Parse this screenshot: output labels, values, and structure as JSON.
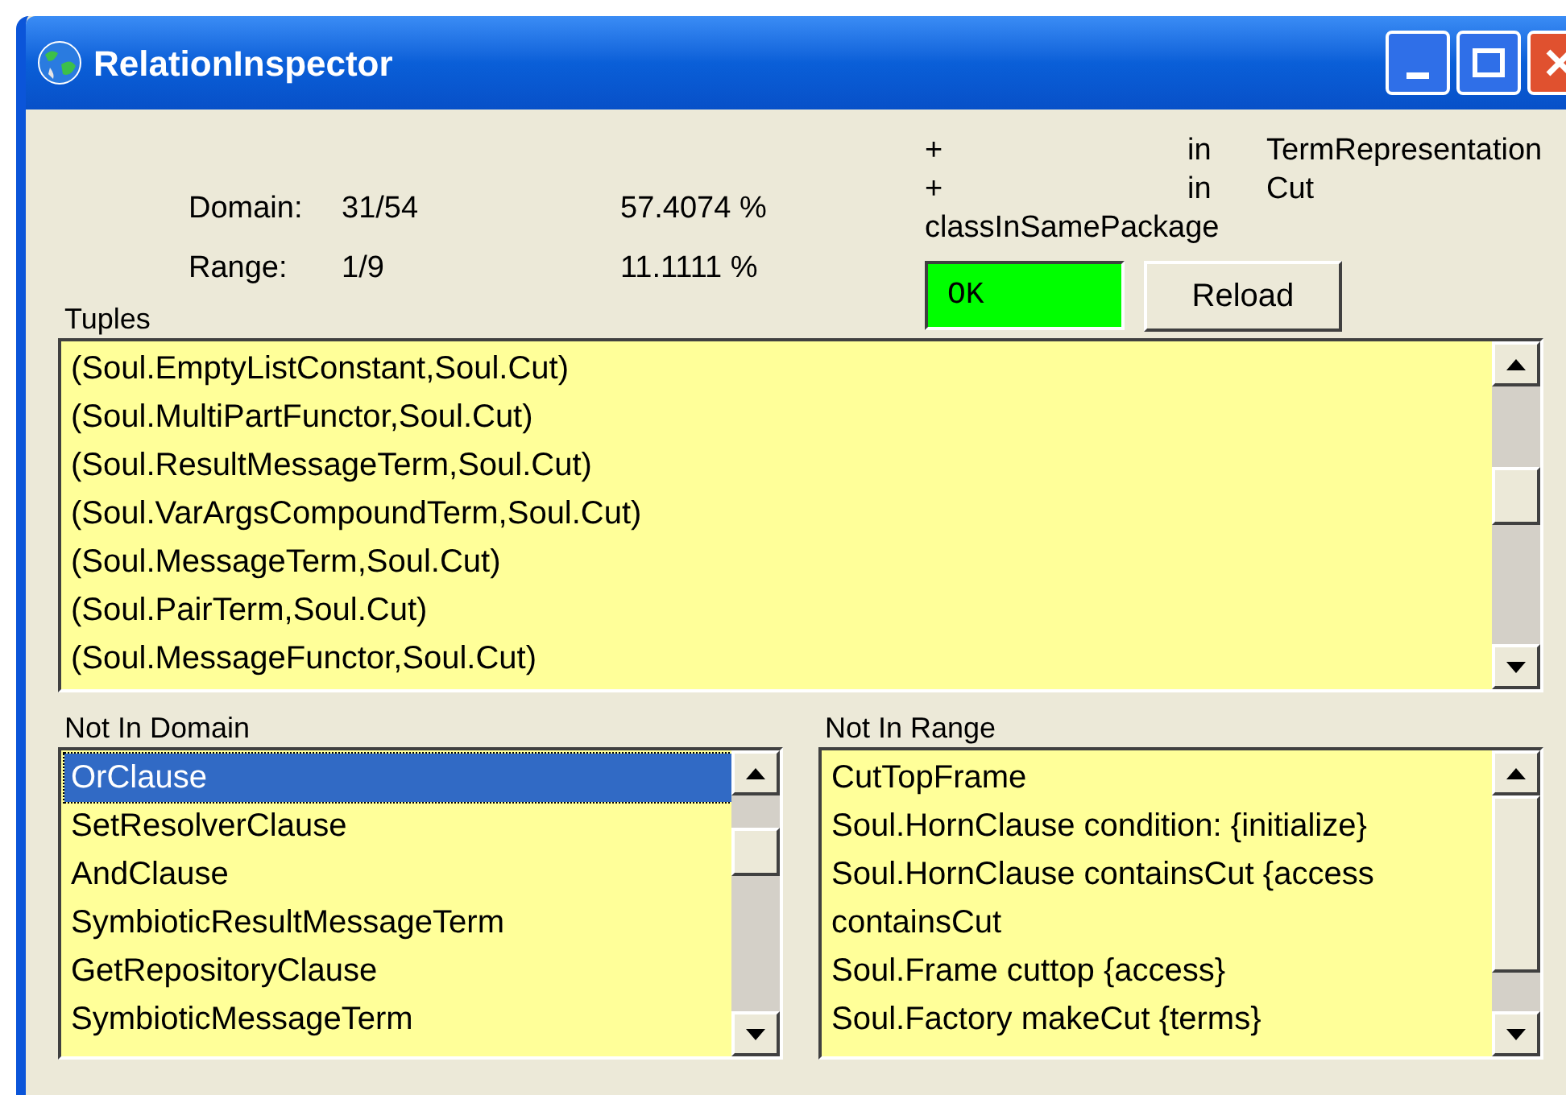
{
  "window": {
    "title": "RelationInspector"
  },
  "stats": [
    {
      "label": "Domain:",
      "count": "31/54",
      "percent": "57.4074 %"
    },
    {
      "label": "Range:",
      "count": "1/9",
      "percent": "11.1111 %"
    }
  ],
  "query_lines": [
    {
      "col_1": "+",
      "col_2": "in",
      "col_3": "TermRepresentation"
    },
    {
      "col_1": "+",
      "col_2": "in",
      "col_3": "Cut"
    }
  ],
  "query_name": "classInSamePackage",
  "status": {
    "text": "OK",
    "color": "#00ff00"
  },
  "reload_button": "Reload",
  "tuples": {
    "label": "Tuples",
    "items": [
      {
        "text": "(Soul.EmptyListConstant,Soul.Cut)",
        "selected": false
      },
      {
        "text": "(Soul.MultiPartFunctor,Soul.Cut)",
        "selected": false
      },
      {
        "text": "(Soul.ResultMessageTerm,Soul.Cut)",
        "selected": false
      },
      {
        "text": "(Soul.VarArgsCompoundTerm,Soul.Cut)",
        "selected": false
      },
      {
        "text": "(Soul.MessageTerm,Soul.Cut)",
        "selected": false
      },
      {
        "text": "(Soul.PairTerm,Soul.Cut)",
        "selected": false
      },
      {
        "text": "(Soul.MessageFunctor,Soul.Cut)",
        "selected": false
      }
    ]
  },
  "not_in_domain": {
    "label": "Not In Domain",
    "items": [
      {
        "text": "OrClause",
        "selected": true
      },
      {
        "text": "SetResolverClause",
        "selected": false
      },
      {
        "text": "AndClause",
        "selected": false
      },
      {
        "text": "SymbioticResultMessageTerm",
        "selected": false
      },
      {
        "text": "GetRepositoryClause",
        "selected": false
      },
      {
        "text": "SymbioticMessageTerm",
        "selected": false
      }
    ]
  },
  "not_in_range": {
    "label": "Not In Range",
    "items": [
      {
        "text": "CutTopFrame",
        "selected": false
      },
      {
        "text": "Soul.HornClause condition: {initialize}",
        "selected": false
      },
      {
        "text": "Soul.HornClause containsCut {access",
        "selected": false
      },
      {
        "text": "containsCut",
        "selected": false
      },
      {
        "text": "Soul.Frame cuttop {access}",
        "selected": false
      },
      {
        "text": "Soul.Factory makeCut {terms}",
        "selected": false
      }
    ]
  }
}
